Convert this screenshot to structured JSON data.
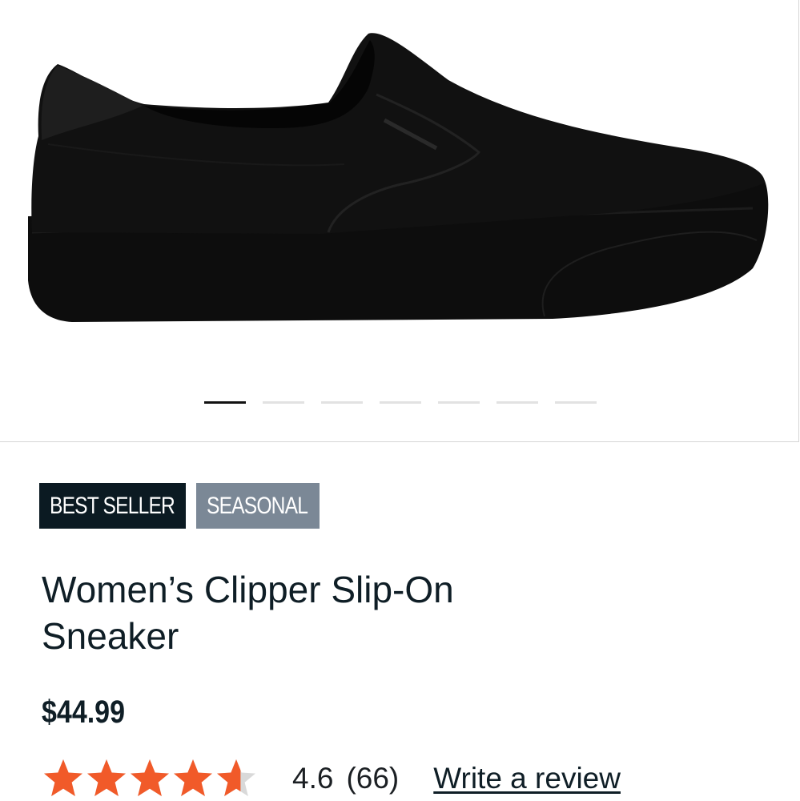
{
  "product": {
    "image_icon": "black-slip-on-sneaker-image",
    "badges": [
      {
        "label": "BEST SELLER",
        "color": "#0b1a22"
      },
      {
        "label": "SEASONAL",
        "color": "#7b8896"
      }
    ],
    "title": "Women’s Clipper Slip-On Sneaker",
    "price": "$44.99",
    "rating": {
      "score": "4.6",
      "count": "(66)",
      "stars_value": 4.6,
      "stars_max": 5,
      "star_color": "#f15a29",
      "empty_star_color": "#d9d9d9"
    },
    "write_review_label": "Write a review"
  },
  "gallery": {
    "slide_count": 7,
    "active_index": 0
  }
}
